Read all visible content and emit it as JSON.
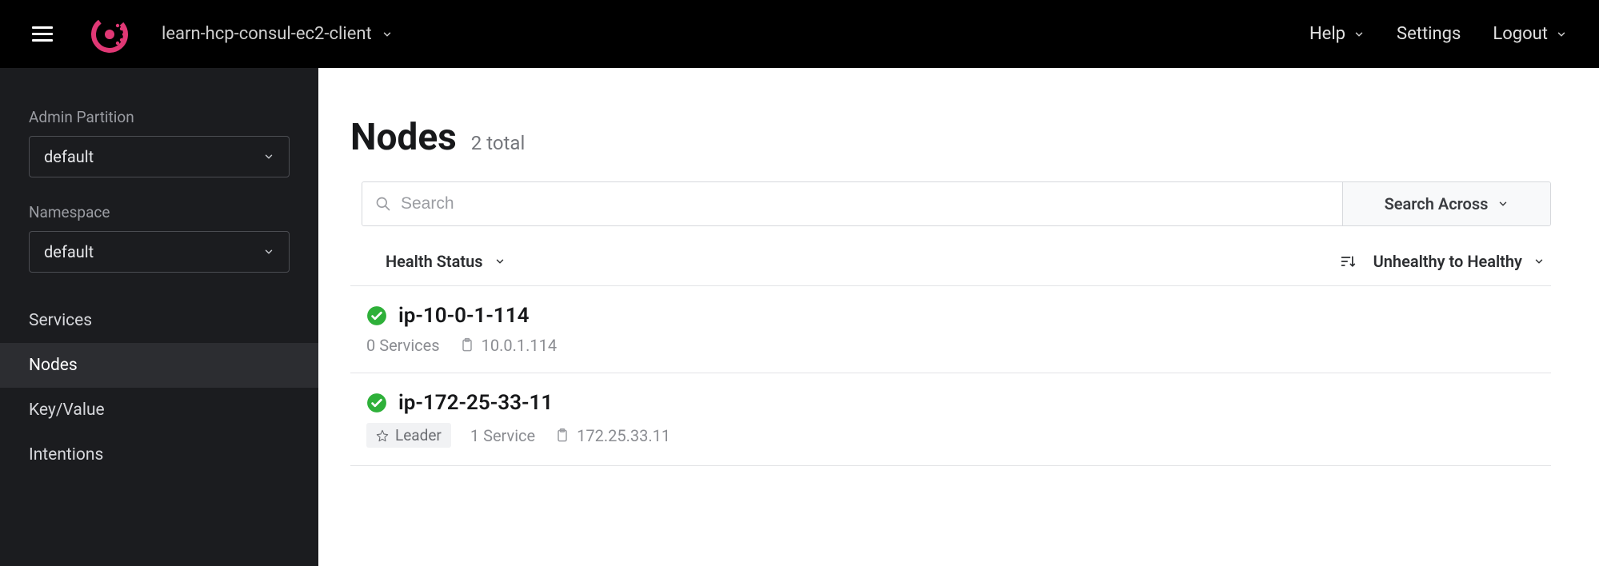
{
  "header": {
    "datacenter": "learn-hcp-consul-ec2-client",
    "nav": {
      "help": "Help",
      "settings": "Settings",
      "logout": "Logout"
    }
  },
  "sidebar": {
    "partition_label": "Admin Partition",
    "partition_value": "default",
    "namespace_label": "Namespace",
    "namespace_value": "default",
    "items": [
      {
        "label": "Services"
      },
      {
        "label": "Nodes"
      },
      {
        "label": "Key/Value"
      },
      {
        "label": "Intentions"
      }
    ]
  },
  "page": {
    "title": "Nodes",
    "subtitle": "2 total"
  },
  "search": {
    "placeholder": "Search",
    "across_label": "Search Across"
  },
  "filters": {
    "health_label": "Health Status",
    "sort_label": "Unhealthy to Healthy"
  },
  "nodes": [
    {
      "name": "ip-10-0-1-114",
      "services": "0 Services",
      "address": "10.0.1.114",
      "leader": false
    },
    {
      "name": "ip-172-25-33-11",
      "services": "1 Service",
      "address": "172.25.33.11",
      "leader": true,
      "leader_label": "Leader"
    }
  ]
}
